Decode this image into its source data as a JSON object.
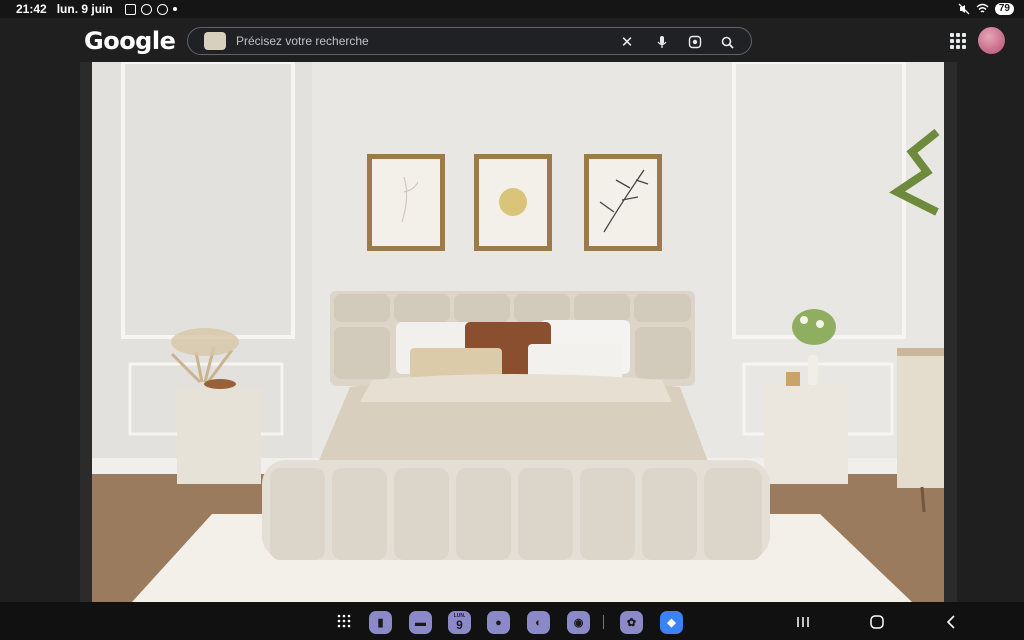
{
  "status_bar": {
    "time": "21:42",
    "date": "lun. 9 juin",
    "battery": "79"
  },
  "header": {
    "logo": "Google",
    "search": {
      "placeholder": "Précisez votre recherche"
    },
    "icons": [
      "close-icon",
      "mic-icon",
      "lens-icon",
      "search-icon",
      "apps-grid-icon"
    ]
  },
  "main_image": {
    "description_icons": [
      "bedroom-photo"
    ],
    "colors": {
      "wall": "#e9e7e3",
      "floor": "#9a7b5e",
      "upholstery": "#ddd5c6"
    }
  },
  "taskbar": {
    "calendar_day": "9",
    "calendar_weekday": "LUN.",
    "accent": "#8c89c9"
  }
}
